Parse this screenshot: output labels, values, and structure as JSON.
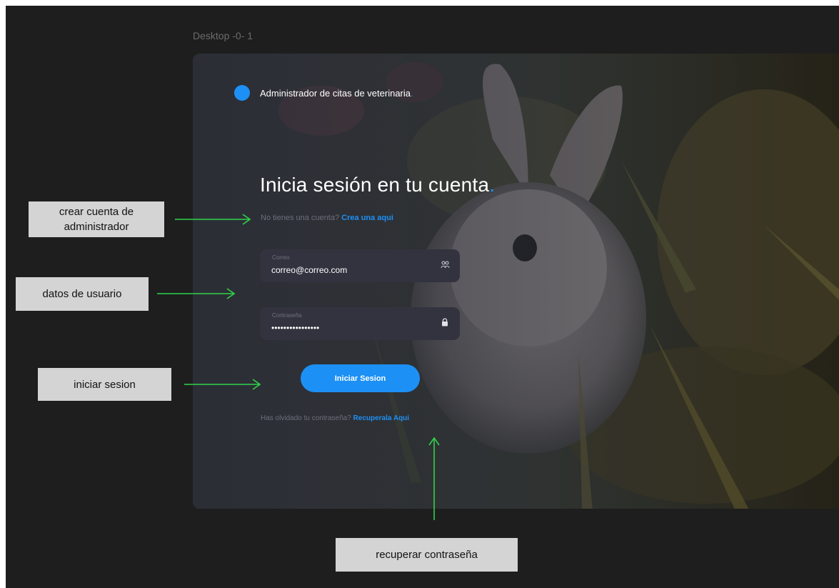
{
  "frame": {
    "label": "Desktop -0- 1"
  },
  "app": {
    "title": "Administrador de citas de veterinaria",
    "title_dot": ".",
    "accent_color": "#1d90f5"
  },
  "login": {
    "heading": "Inicia sesión en tu cuenta",
    "heading_dot": ".",
    "signup_prompt": "No tienes una cuenta?",
    "signup_link": "Crea una aqui",
    "email": {
      "label": "Correo",
      "value": "correo@correo.com",
      "icon": "users-icon"
    },
    "password": {
      "label": "Contraseña",
      "value": "••••••••••••••••",
      "icon": "lock-icon"
    },
    "submit_label": "Iniciar Sesion",
    "forgot_prompt": "Has olvidado tu contraseña?",
    "forgot_link": "Recuperala Aqui"
  },
  "annotations": {
    "create_account": "crear cuenta de administrador",
    "user_data": "datos de usuario",
    "login": "iniciar sesion",
    "recover": "recuperar contraseña",
    "arrow_color": "#2fd34a"
  }
}
